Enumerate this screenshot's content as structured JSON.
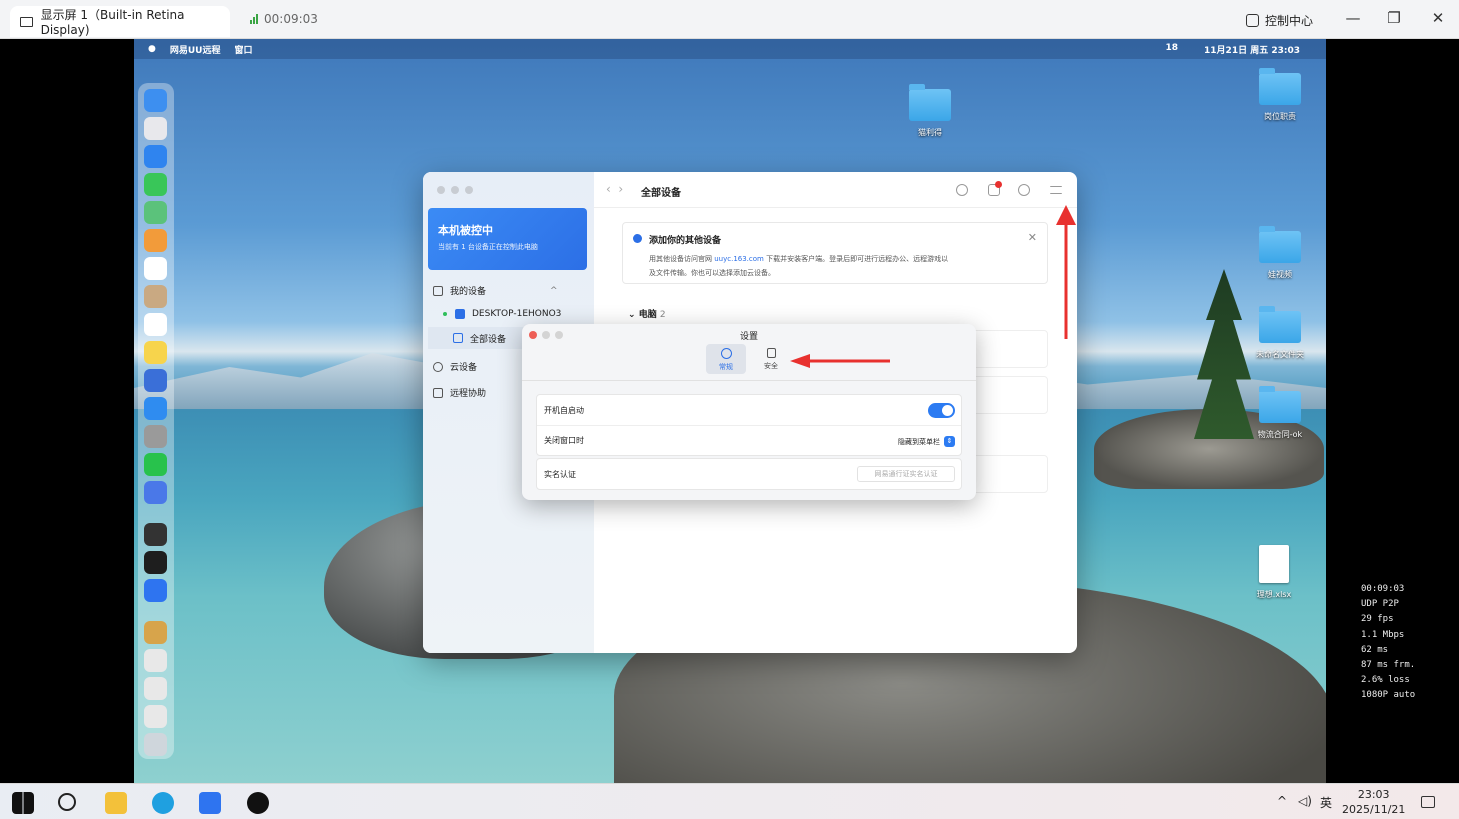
{
  "window": {
    "tab_title": "显示屏 1（Built-in Retina Display)",
    "timer": "00:09:03",
    "control_center": "控制中心",
    "minimize": "—",
    "restore": "❐",
    "close": "✕"
  },
  "mac_menubar": {
    "app": "网易UU远程",
    "menu": "窗口",
    "right_items": [
      "18",
      "11月21日 周五 23:03"
    ]
  },
  "desktop_icons": [
    "猫利得",
    "岗位职责",
    "娃视频",
    "未命名文件夹",
    "物流合同-ok",
    "理想.xlsx"
  ],
  "uu": {
    "control_card": {
      "title": "本机被控中",
      "subtitle": "当前有 1 台设备正在控制此电脑"
    },
    "sidebar": {
      "my_devices": "我的设备",
      "device": "DESKTOP-1EHONO3",
      "all_devices": "全部设备",
      "cloud": "云设备",
      "remote_assist": "远程协助"
    },
    "header_title": "全部设备",
    "notice": {
      "title": "添加你的其他设备",
      "body_1": "用其他设备访问官网",
      "link": "uuyc.163.com",
      "body_2": "下载并安装客户端。登录后即可进行远程办公、远程游戏以",
      "body_3": "及文件传输。你也可以选择添加云设备。",
      "close": "✕"
    },
    "section_pc": "电脑",
    "section_pc_count": "2"
  },
  "settings": {
    "title": "设置",
    "tabs": [
      {
        "label": "常规"
      },
      {
        "label": "安全"
      }
    ],
    "autostart": "开机自启动",
    "close_window": "关闭窗口时",
    "close_option": "隐藏到菜单栏",
    "realname": "实名认证",
    "realname_btn": "网易通行证实名认证"
  },
  "stats": [
    "00:09:03",
    "UDP P2P",
    "29 fps",
    "1.1 Mbps",
    "62 ms",
    "87 ms frm.",
    "2.6% loss",
    "1080P auto"
  ],
  "taskbar": {
    "lang": "英",
    "time": "23:03",
    "date": "2025/11/21"
  },
  "colors": {
    "accent": "#2c7bf2",
    "annotation_arrow": "#e8312f"
  }
}
